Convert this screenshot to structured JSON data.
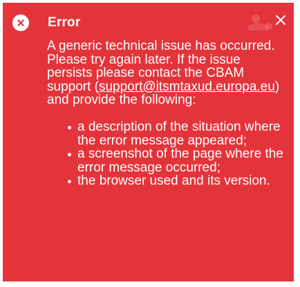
{
  "dialog": {
    "title": "Error",
    "icons": {
      "status": "error-x-circle-icon",
      "close": "close-x-icon"
    },
    "message": {
      "text_before_link": "A generic technical issue has occurred. Please try again later. If the issue persists please contact the CBAM support (",
      "link_text": "support@itsmtaxud.europa.eu",
      "text_after_link": ") and provide the following:"
    },
    "list_items": [
      "a description of the situation where the error message appeared;",
      "a screenshot of the page where the error message occurred;",
      "the browser used and its version."
    ]
  },
  "colors": {
    "dialog_background": "#e3343b",
    "text": "#ffffff",
    "icon_glyph": "#e3343b"
  }
}
